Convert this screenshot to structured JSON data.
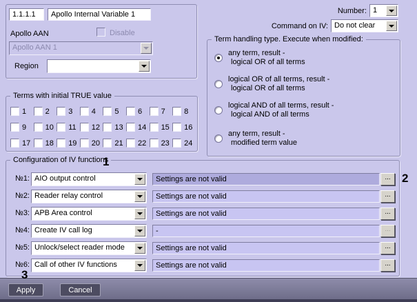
{
  "identity": {
    "id_value": "1.1.1.1",
    "name_value": "Apollo Internal Variable 1",
    "aan_label": "Apollo AAN",
    "disable_label": "Disable",
    "aan_value": "Apollo AAN 1",
    "region_label": "Region",
    "region_value": ""
  },
  "header_right": {
    "number_label": "Number:",
    "number_value": "1",
    "command_label": "Command on IV:",
    "command_value": "Do not clear"
  },
  "term_handling": {
    "title": "Term handling type. Execute when modified:",
    "selected_index": 0,
    "options": [
      {
        "line1": "any term, result -",
        "line2": "logical OR of all terms"
      },
      {
        "line1": "logical OR of all terms, result -",
        "line2": "logical OR of all terms"
      },
      {
        "line1": "logical AND of all terms, result -",
        "line2": "logical AND of all terms"
      },
      {
        "line1": "any term, result -",
        "line2": "modified term value"
      }
    ]
  },
  "terms": {
    "title": "Terms with initial TRUE value",
    "labels": [
      "1",
      "2",
      "3",
      "4",
      "5",
      "6",
      "7",
      "8",
      "9",
      "10",
      "11",
      "12",
      "13",
      "14",
      "15",
      "16",
      "17",
      "18",
      "19",
      "20",
      "21",
      "22",
      "23",
      "24"
    ],
    "checked_labels": []
  },
  "config": {
    "title": "Configuration of IV functions",
    "more_label": "...",
    "rows": [
      {
        "label": "№1:",
        "function": "AIO output control",
        "status": "Settings are not valid"
      },
      {
        "label": "№2:",
        "function": "Reader relay control",
        "status": "Settings are not valid"
      },
      {
        "label": "№3:",
        "function": "APB Area control",
        "status": "Settings are not valid"
      },
      {
        "label": "№4:",
        "function": "Create IV call log",
        "status": "-"
      },
      {
        "label": "№5:",
        "function": "Unlock/select reader mode",
        "status": "Settings are not valid"
      },
      {
        "label": "№6:",
        "function": "Call of other IV functions",
        "status": "Settings are not valid"
      }
    ]
  },
  "footer": {
    "apply_label": "Apply",
    "cancel_label": "Cancel"
  },
  "callouts": {
    "c1": "1",
    "c2": "2",
    "c3": "3"
  },
  "colors": {
    "dialog_bg": "#cac7eb",
    "bottom_bar": "#7a7996",
    "status_bg": "#c8c5f2",
    "status_selected_bg": "#aeabdd",
    "dark_button_bg": "#4d4c61"
  }
}
